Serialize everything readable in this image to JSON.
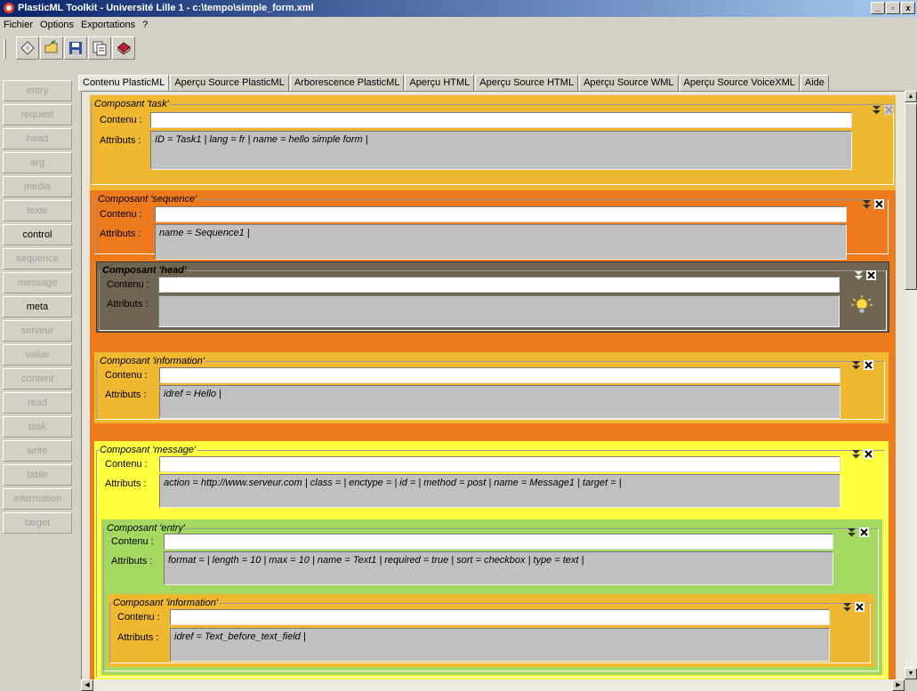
{
  "window": {
    "title": "PlasticML Toolkit - Université Lille 1 - c:\\tempo\\simple_form.xml",
    "controls": {
      "minimize": "_",
      "maximize": "▫",
      "close": "x"
    }
  },
  "menu": [
    "Fichier",
    "Options",
    "Exportations",
    "?"
  ],
  "toolbar": {
    "icons": [
      "new-icon",
      "open-icon",
      "save-icon",
      "copy-icon",
      "book-icon"
    ]
  },
  "sidebar": {
    "items": [
      {
        "label": "entry",
        "enabled": false
      },
      {
        "label": "request",
        "enabled": false
      },
      {
        "label": "head",
        "enabled": false
      },
      {
        "label": "arg",
        "enabled": false
      },
      {
        "label": "media",
        "enabled": false
      },
      {
        "label": "texte",
        "enabled": false
      },
      {
        "label": "control",
        "enabled": true
      },
      {
        "label": "sequence",
        "enabled": false
      },
      {
        "label": "message",
        "enabled": false
      },
      {
        "label": "meta",
        "enabled": true
      },
      {
        "label": "serveur",
        "enabled": false
      },
      {
        "label": "value",
        "enabled": false
      },
      {
        "label": "content",
        "enabled": false
      },
      {
        "label": "read",
        "enabled": false
      },
      {
        "label": "task",
        "enabled": false
      },
      {
        "label": "write",
        "enabled": false
      },
      {
        "label": "table",
        "enabled": false
      },
      {
        "label": "information",
        "enabled": false
      },
      {
        "label": "target",
        "enabled": false
      }
    ]
  },
  "tabs": [
    {
      "label": "Contenu PlasticML",
      "active": true
    },
    {
      "label": "Aperçu Source PlasticML",
      "active": false
    },
    {
      "label": "Arborescence PlasticML",
      "active": false
    },
    {
      "label": "Aperçu HTML",
      "active": false
    },
    {
      "label": "Aperçu Source HTML",
      "active": false
    },
    {
      "label": "Aperçu Source WML",
      "active": false
    },
    {
      "label": "Aperçu Source VoiceXML",
      "active": false
    },
    {
      "label": "Aide",
      "active": false
    }
  ],
  "labels": {
    "contenu": "Contenu :",
    "attributs": "Attributs :"
  },
  "components": {
    "task": {
      "legend": "Composant 'task'",
      "color": "#f0b830",
      "contenu": "",
      "attributs": "ID = Task1   |   lang = fr   |   name = hello simple form   |"
    },
    "sequence": {
      "legend": "Composant 'sequence'",
      "color": "#ee7a1e",
      "contenu": "",
      "attributs": "name = Sequence1   |"
    },
    "head": {
      "legend": "Composant 'head'",
      "color": "#6e6650",
      "contenu": "",
      "attributs": "",
      "icon": "lightbulb-icon"
    },
    "information1": {
      "legend": "Composant 'information'",
      "color": "#f0b830",
      "contenu": "",
      "attributs": "idref = Hello   |"
    },
    "message": {
      "legend": "Composant 'message'",
      "color": "#ffff40",
      "contenu": "",
      "attributs": "action = http://www.serveur.com   |   class =   |   enctype =   |   id =   |   method = post   |   name = Message1   |   target =   |"
    },
    "entry": {
      "legend": "Composant 'entry'",
      "color": "#a4d860",
      "contenu": "",
      "attributs": "format =   |   length = 10   |   max = 10   |   name = Text1   |   required = true   |   sort = checkbox   |   type = text   |"
    },
    "information2": {
      "legend": "Composant 'information'",
      "color": "#f0b830",
      "contenu": "",
      "attributs": "idref = Text_before_text_field   |"
    }
  }
}
